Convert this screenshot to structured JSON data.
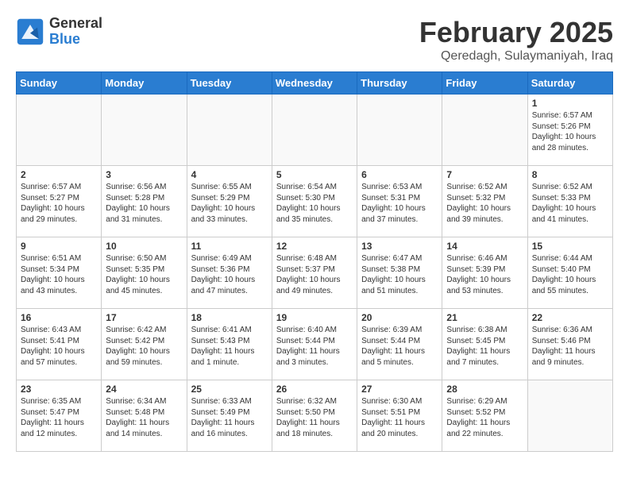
{
  "header": {
    "logo_general": "General",
    "logo_blue": "Blue",
    "title": "February 2025",
    "subtitle": "Qeredagh, Sulaymaniyah, Iraq"
  },
  "days_of_week": [
    "Sunday",
    "Monday",
    "Tuesday",
    "Wednesday",
    "Thursday",
    "Friday",
    "Saturday"
  ],
  "weeks": [
    [
      {
        "day": "",
        "info": ""
      },
      {
        "day": "",
        "info": ""
      },
      {
        "day": "",
        "info": ""
      },
      {
        "day": "",
        "info": ""
      },
      {
        "day": "",
        "info": ""
      },
      {
        "day": "",
        "info": ""
      },
      {
        "day": "1",
        "info": "Sunrise: 6:57 AM\nSunset: 5:26 PM\nDaylight: 10 hours and 28 minutes."
      }
    ],
    [
      {
        "day": "2",
        "info": "Sunrise: 6:57 AM\nSunset: 5:27 PM\nDaylight: 10 hours and 29 minutes."
      },
      {
        "day": "3",
        "info": "Sunrise: 6:56 AM\nSunset: 5:28 PM\nDaylight: 10 hours and 31 minutes."
      },
      {
        "day": "4",
        "info": "Sunrise: 6:55 AM\nSunset: 5:29 PM\nDaylight: 10 hours and 33 minutes."
      },
      {
        "day": "5",
        "info": "Sunrise: 6:54 AM\nSunset: 5:30 PM\nDaylight: 10 hours and 35 minutes."
      },
      {
        "day": "6",
        "info": "Sunrise: 6:53 AM\nSunset: 5:31 PM\nDaylight: 10 hours and 37 minutes."
      },
      {
        "day": "7",
        "info": "Sunrise: 6:52 AM\nSunset: 5:32 PM\nDaylight: 10 hours and 39 minutes."
      },
      {
        "day": "8",
        "info": "Sunrise: 6:52 AM\nSunset: 5:33 PM\nDaylight: 10 hours and 41 minutes."
      }
    ],
    [
      {
        "day": "9",
        "info": "Sunrise: 6:51 AM\nSunset: 5:34 PM\nDaylight: 10 hours and 43 minutes."
      },
      {
        "day": "10",
        "info": "Sunrise: 6:50 AM\nSunset: 5:35 PM\nDaylight: 10 hours and 45 minutes."
      },
      {
        "day": "11",
        "info": "Sunrise: 6:49 AM\nSunset: 5:36 PM\nDaylight: 10 hours and 47 minutes."
      },
      {
        "day": "12",
        "info": "Sunrise: 6:48 AM\nSunset: 5:37 PM\nDaylight: 10 hours and 49 minutes."
      },
      {
        "day": "13",
        "info": "Sunrise: 6:47 AM\nSunset: 5:38 PM\nDaylight: 10 hours and 51 minutes."
      },
      {
        "day": "14",
        "info": "Sunrise: 6:46 AM\nSunset: 5:39 PM\nDaylight: 10 hours and 53 minutes."
      },
      {
        "day": "15",
        "info": "Sunrise: 6:44 AM\nSunset: 5:40 PM\nDaylight: 10 hours and 55 minutes."
      }
    ],
    [
      {
        "day": "16",
        "info": "Sunrise: 6:43 AM\nSunset: 5:41 PM\nDaylight: 10 hours and 57 minutes."
      },
      {
        "day": "17",
        "info": "Sunrise: 6:42 AM\nSunset: 5:42 PM\nDaylight: 10 hours and 59 minutes."
      },
      {
        "day": "18",
        "info": "Sunrise: 6:41 AM\nSunset: 5:43 PM\nDaylight: 11 hours and 1 minute."
      },
      {
        "day": "19",
        "info": "Sunrise: 6:40 AM\nSunset: 5:44 PM\nDaylight: 11 hours and 3 minutes."
      },
      {
        "day": "20",
        "info": "Sunrise: 6:39 AM\nSunset: 5:44 PM\nDaylight: 11 hours and 5 minutes."
      },
      {
        "day": "21",
        "info": "Sunrise: 6:38 AM\nSunset: 5:45 PM\nDaylight: 11 hours and 7 minutes."
      },
      {
        "day": "22",
        "info": "Sunrise: 6:36 AM\nSunset: 5:46 PM\nDaylight: 11 hours and 9 minutes."
      }
    ],
    [
      {
        "day": "23",
        "info": "Sunrise: 6:35 AM\nSunset: 5:47 PM\nDaylight: 11 hours and 12 minutes."
      },
      {
        "day": "24",
        "info": "Sunrise: 6:34 AM\nSunset: 5:48 PM\nDaylight: 11 hours and 14 minutes."
      },
      {
        "day": "25",
        "info": "Sunrise: 6:33 AM\nSunset: 5:49 PM\nDaylight: 11 hours and 16 minutes."
      },
      {
        "day": "26",
        "info": "Sunrise: 6:32 AM\nSunset: 5:50 PM\nDaylight: 11 hours and 18 minutes."
      },
      {
        "day": "27",
        "info": "Sunrise: 6:30 AM\nSunset: 5:51 PM\nDaylight: 11 hours and 20 minutes."
      },
      {
        "day": "28",
        "info": "Sunrise: 6:29 AM\nSunset: 5:52 PM\nDaylight: 11 hours and 22 minutes."
      },
      {
        "day": "",
        "info": ""
      }
    ]
  ]
}
